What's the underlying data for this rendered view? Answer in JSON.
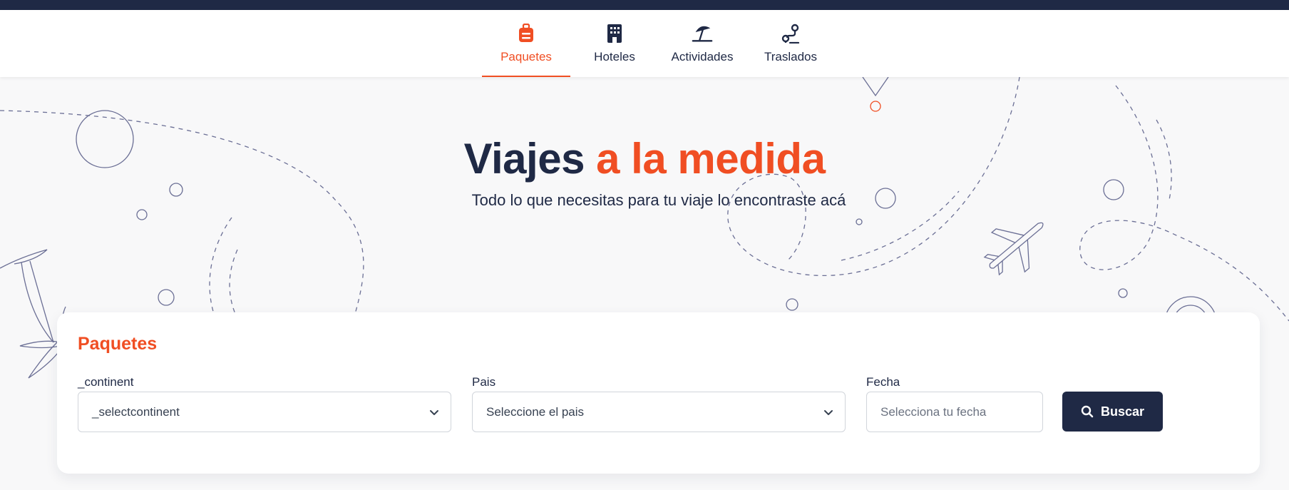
{
  "colors": {
    "accent": "#f04e23",
    "navy": "#1f2945"
  },
  "nav": {
    "tabs": [
      {
        "label": "Paquetes",
        "icon": "suitcase-icon",
        "active": true
      },
      {
        "label": "Hoteles",
        "icon": "hotel-building-icon",
        "active": false
      },
      {
        "label": "Actividades",
        "icon": "beach-umbrella-icon",
        "active": false
      },
      {
        "label": "Traslados",
        "icon": "route-pin-icon",
        "active": false
      }
    ]
  },
  "hero": {
    "title_main": "Viajes",
    "title_accent": "a la medida",
    "subtitle": "Todo lo que necesitas para tu viaje lo encontraste acá"
  },
  "search": {
    "title": "Paquetes",
    "continent": {
      "label": "_continent",
      "value": "_selectcontinent"
    },
    "country": {
      "label": "Pais",
      "value": "Seleccione el pais"
    },
    "date": {
      "label": "Fecha",
      "placeholder": "Selecciona tu fecha"
    },
    "button_label": "Buscar",
    "button_icon": "search-icon"
  }
}
